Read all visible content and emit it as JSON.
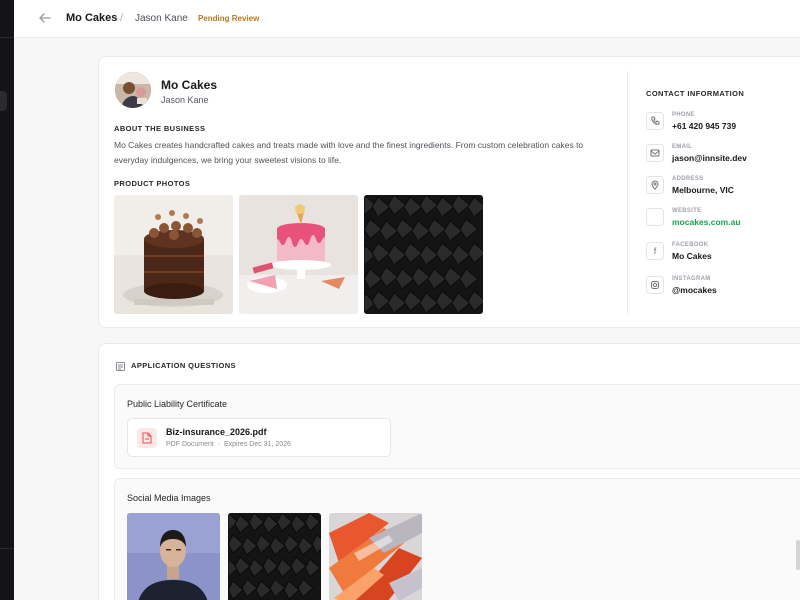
{
  "header": {
    "business": "Mo Cakes",
    "separator": "/",
    "owner": "Jason Kane",
    "status": "Pending Review"
  },
  "profile": {
    "name": "Mo Cakes",
    "owner": "Jason Kane",
    "about_label": "ABOUT THE BUSINESS",
    "about_text": "Mo Cakes creates handcrafted cakes and treats made with love and the finest ingredients. From custom celebration cakes to everyday indulgences, we bring your sweetest visions to life.",
    "photos_label": "PRODUCT PHOTOS"
  },
  "contact": {
    "title": "CONTACT INFORMATION",
    "items": [
      {
        "label": "PHONE",
        "value": "+61 420 945 739",
        "icon": "phone-icon"
      },
      {
        "label": "EMAIL",
        "value": "jason@innsite.dev",
        "icon": "mail-icon"
      },
      {
        "label": "ADDRESS",
        "value": "Melbourne, VIC",
        "icon": "location-icon"
      },
      {
        "label": "WEBSITE",
        "value": "mocakes.com.au",
        "icon": "globe-icon"
      },
      {
        "label": "FACEBOOK",
        "value": "Mo Cakes",
        "icon": "facebook-icon"
      },
      {
        "label": "INSTAGRAM",
        "value": "@mocakes",
        "icon": "instagram-icon"
      }
    ]
  },
  "questions": {
    "title": "APPLICATION QUESTIONS",
    "liability": {
      "title": "Public Liability Certificate",
      "file_name": "Biz-insurance_2026.pdf",
      "file_type": "PDF Document",
      "file_dot": "·",
      "file_expiry": "Expires Dec 31, 2026"
    },
    "social": {
      "title": "Social Media Images"
    }
  },
  "colors": {
    "accent_link": "#16a34a",
    "status": "#b7791f",
    "sidebar": "#141416"
  }
}
